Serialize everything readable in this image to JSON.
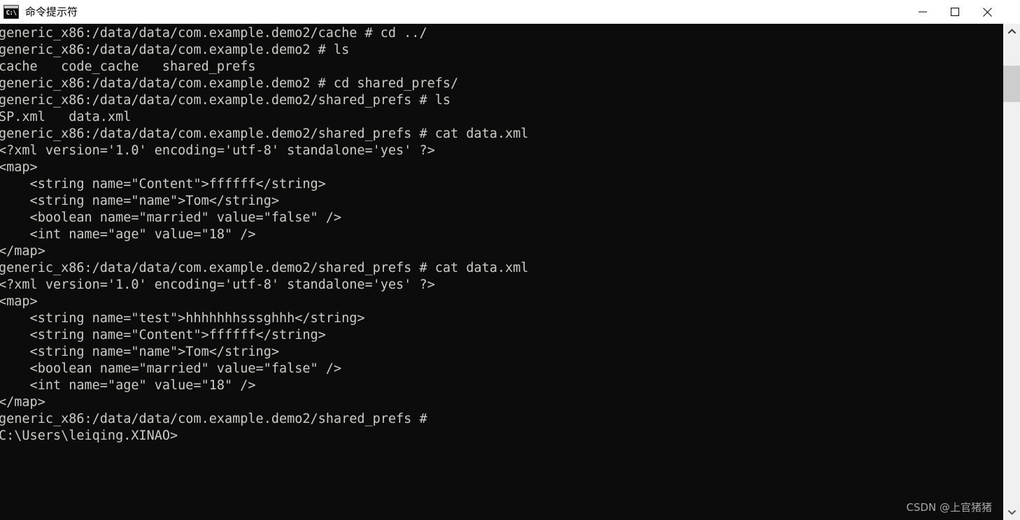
{
  "window": {
    "title": "命令提示符",
    "icon": "cmd-icon",
    "icon_prompt_text": "C:\\",
    "background_color": "#0c0c0c",
    "titlebar_color": "#ffffff",
    "text_color": "#ccccc8",
    "controls": {
      "minimize_label": "最小化",
      "maximize_label": "最大化",
      "close_label": "关闭"
    }
  },
  "terminal": {
    "content": "generic_x86:/data/data/com.example.demo2/cache # cd ../\ngeneric_x86:/data/data/com.example.demo2 # ls\ncache   code_cache   shared_prefs\ngeneric_x86:/data/data/com.example.demo2 # cd shared_prefs/\ngeneric_x86:/data/data/com.example.demo2/shared_prefs # ls\nSP.xml   data.xml\ngeneric_x86:/data/data/com.example.demo2/shared_prefs # cat data.xml\n<?xml version='1.0' encoding='utf-8' standalone='yes' ?>\n<map>\n    <string name=\"Content\">ffffff</string>\n    <string name=\"name\">Tom</string>\n    <boolean name=\"married\" value=\"false\" />\n    <int name=\"age\" value=\"18\" />\n</map>\ngeneric_x86:/data/data/com.example.demo2/shared_prefs # cat data.xml\n<?xml version='1.0' encoding='utf-8' standalone='yes' ?>\n<map>\n    <string name=\"test\">hhhhhhhsssghhh</string>\n    <string name=\"Content\">ffffff</string>\n    <string name=\"name\">Tom</string>\n    <boolean name=\"married\" value=\"false\" />\n    <int name=\"age\" value=\"18\" />\n</map>\ngeneric_x86:/data/data/com.example.demo2/shared_prefs #\nC:\\Users\\leiqing.XINAO>",
    "lines": [
      "generic_x86:/data/data/com.example.demo2/cache # cd ../",
      "generic_x86:/data/data/com.example.demo2 # ls",
      "cache   code_cache   shared_prefs",
      "generic_x86:/data/data/com.example.demo2 # cd shared_prefs/",
      "generic_x86:/data/data/com.example.demo2/shared_prefs # ls",
      "SP.xml   data.xml",
      "generic_x86:/data/data/com.example.demo2/shared_prefs # cat data.xml",
      "<?xml version='1.0' encoding='utf-8' standalone='yes' ?>",
      "<map>",
      "    <string name=\"Content\">ffffff</string>",
      "    <string name=\"name\">Tom</string>",
      "    <boolean name=\"married\" value=\"false\" />",
      "    <int name=\"age\" value=\"18\" />",
      "</map>",
      "generic_x86:/data/data/com.example.demo2/shared_prefs # cat data.xml",
      "<?xml version='1.0' encoding='utf-8' standalone='yes' ?>",
      "<map>",
      "    <string name=\"test\">hhhhhhhsssghhh</string>",
      "    <string name=\"Content\">ffffff</string>",
      "    <string name=\"name\">Tom</string>",
      "    <boolean name=\"married\" value=\"false\" />",
      "    <int name=\"age\" value=\"18\" />",
      "</map>",
      "generic_x86:/data/data/com.example.demo2/shared_prefs #",
      "C:\\Users\\leiqing.XINAO>"
    ]
  },
  "scrollbar": {
    "up_arrow_icon": "chevron-up-icon",
    "down_arrow_icon": "chevron-down-icon",
    "thumb_position_percent": 6
  },
  "watermark": {
    "text": "CSDN @上官猪猪"
  }
}
